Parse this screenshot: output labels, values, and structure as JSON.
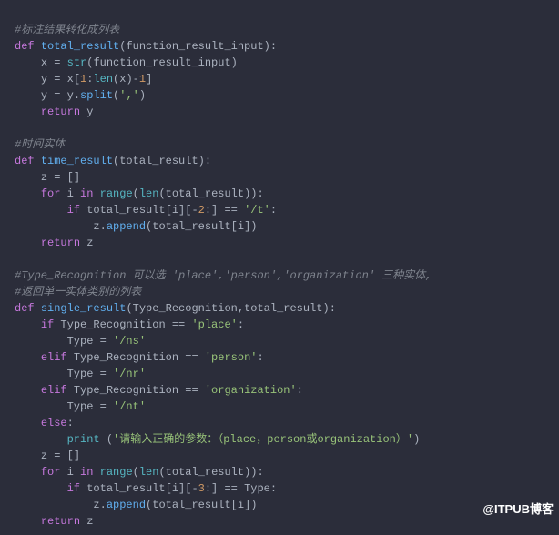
{
  "comments": {
    "c1": "#标注结果转化成列表",
    "c2": "#时间实体",
    "c3": "#Type_Recognition 可以选 'place','person','organization' 三种实体,",
    "c4": "#返回单一实体类别的列表"
  },
  "kw": {
    "def": "def",
    "return": "return",
    "for": "for",
    "in": "in",
    "if": "if",
    "elif": "elif",
    "else": "else"
  },
  "fn": {
    "total_result": "total_result",
    "time_result": "time_result",
    "single_result": "single_result",
    "str": "str",
    "len": "len",
    "range": "range",
    "split": "split",
    "append": "append",
    "print": "print"
  },
  "id": {
    "function_result_input": "function_result_input",
    "total_result": "total_result",
    "Type_Recognition": "Type_Recognition",
    "x": "x",
    "y": "y",
    "z": "z",
    "i": "i",
    "Type": "Type"
  },
  "num": {
    "one": "1",
    "two": "2",
    "three": "3",
    "minus_one": "-1"
  },
  "str": {
    "comma": "','",
    "slash_t": "'/t'",
    "place": "'place'",
    "person": "'person'",
    "organization": "'organization'",
    "ns": "'/ns'",
    "nr": "'/nr'",
    "nt": "'/nt'",
    "err": "'请输入正确的参数：（place，person或organization）'"
  },
  "p": {
    "lparen": "(",
    "rparen": ")",
    "colon": ":",
    "lbrack": "[",
    "rbrack": "]",
    "eq": " = ",
    "eqeq": " == ",
    "dot": ".",
    "comma_sp": ",",
    "minus": "-",
    "empty_list": "[]",
    "slice_neg2": "[-2:]",
    "slice_neg3": "[-3:]"
  },
  "watermark": "@ITPUB博客"
}
